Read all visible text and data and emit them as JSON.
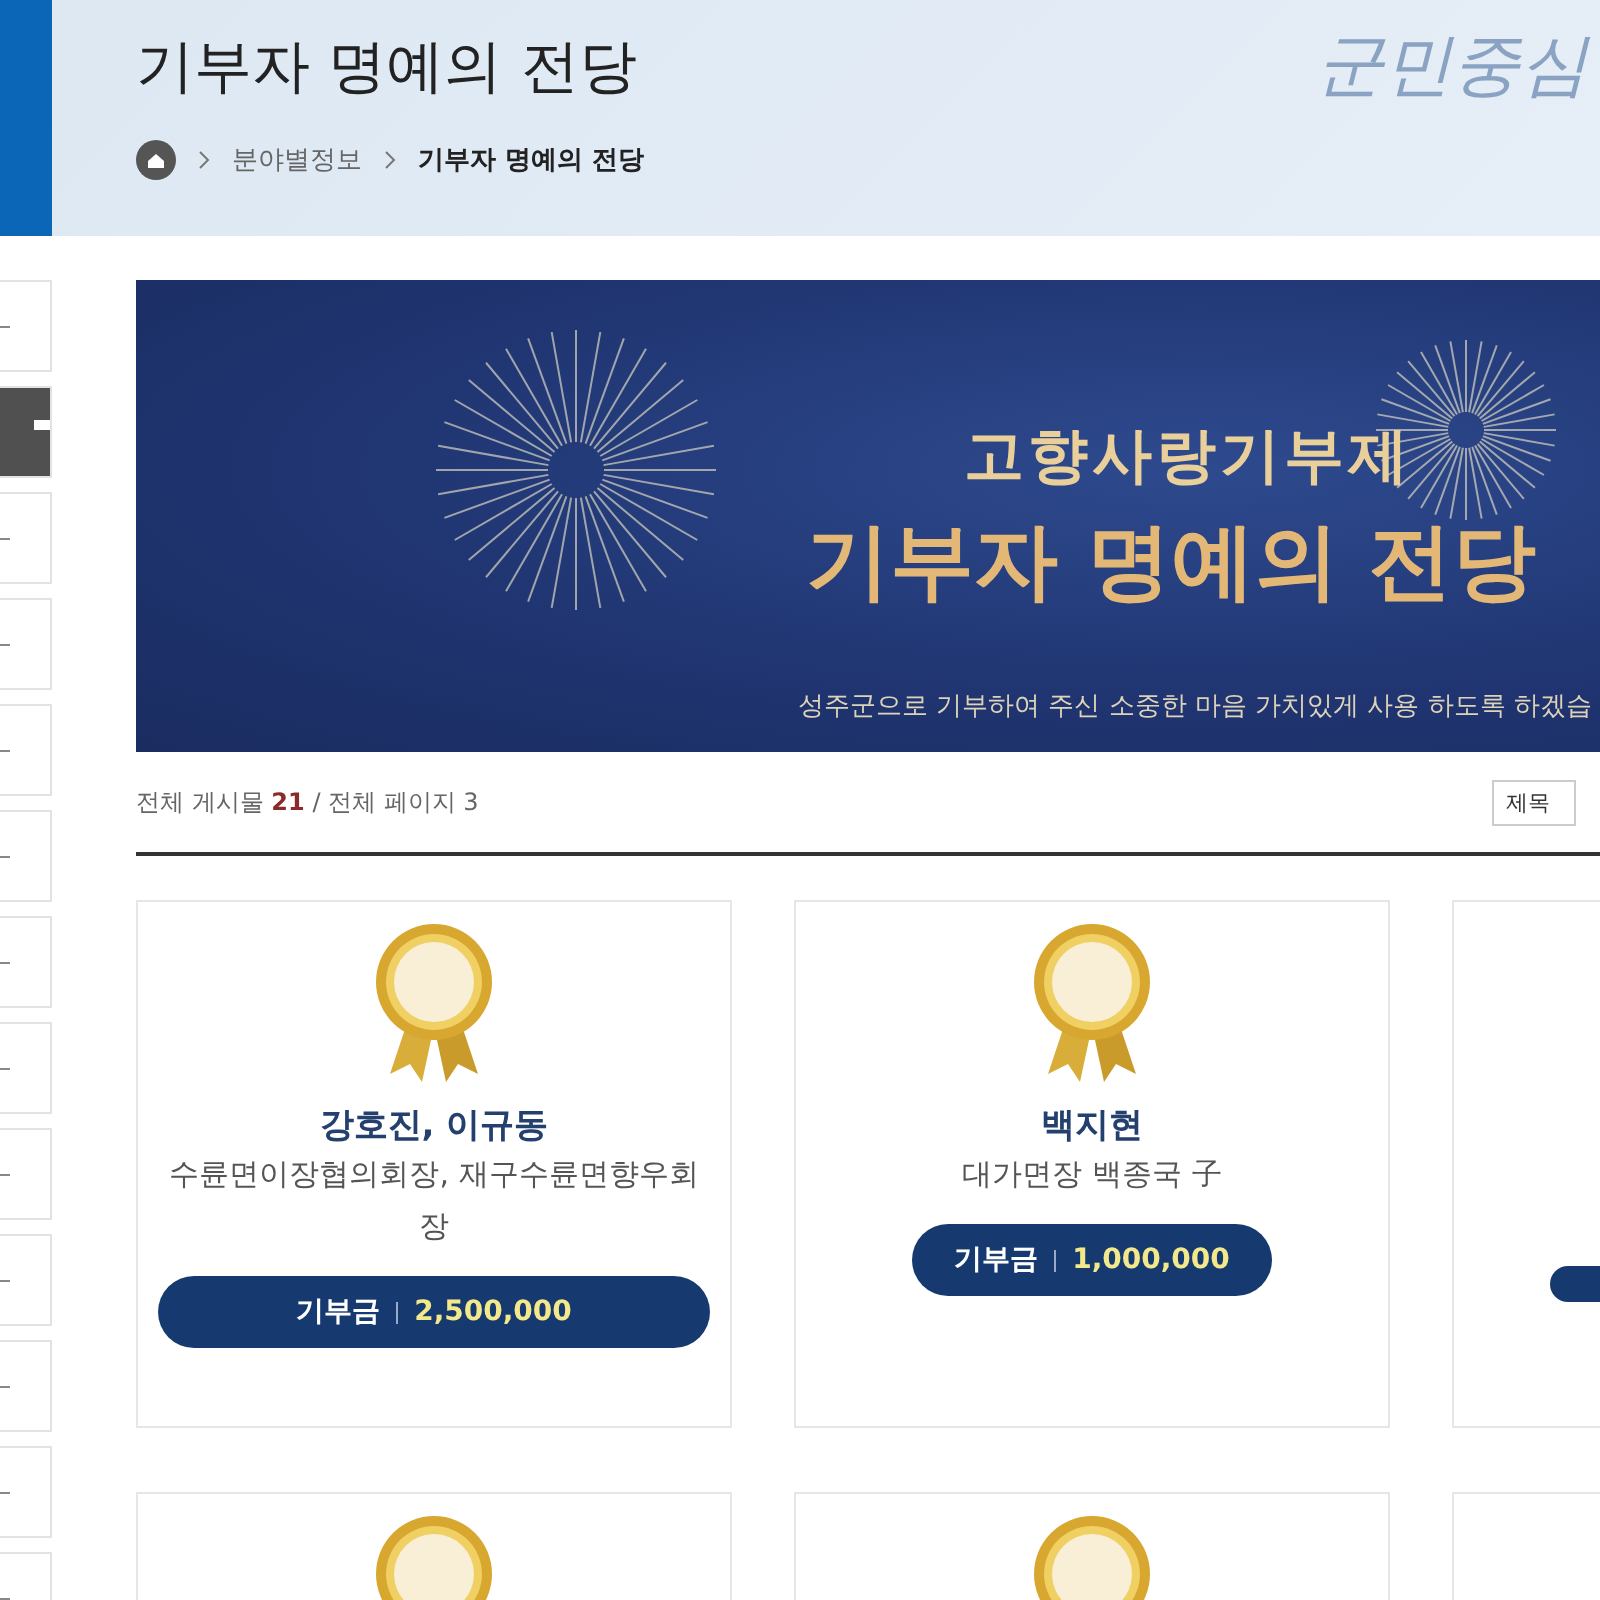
{
  "header": {
    "title": "기부자 명예의 전당",
    "motto": "군민중심",
    "breadcrumb": [
      {
        "label": "분야별정보",
        "current": false
      },
      {
        "label": "기부자 명예의 전당",
        "current": true
      }
    ]
  },
  "side_menu": [
    {
      "selected": false
    },
    {
      "selected": true
    },
    {
      "selected": false
    },
    {
      "selected": false
    },
    {
      "selected": false
    },
    {
      "selected": false
    },
    {
      "selected": false
    },
    {
      "selected": false
    },
    {
      "selected": false
    },
    {
      "selected": false
    },
    {
      "selected": false
    },
    {
      "selected": false
    },
    {
      "selected": false
    }
  ],
  "banner": {
    "subtitle": "고향사랑기부제",
    "title": "기부자 명예의 전당",
    "message": "성주군으로  기부하여 주신 소중한 마음 가치있게 사용 하도록 하겠습"
  },
  "summary": {
    "posts_label": "전체 게시물",
    "posts": "21",
    "pages_label": "/ 전체 페이지 3"
  },
  "search_select": {
    "value": "제목"
  },
  "cards": [
    {
      "kind": "donor",
      "name": "강호진, 이규동",
      "title": "수륜면이장협의회장, 재구수륜면향우회장",
      "label": "기부금",
      "amount": "2,500,000"
    },
    {
      "kind": "donor",
      "name": "백지현",
      "title": "대가면장 백종국 子",
      "label": "기부금",
      "amount": "1,000,000"
    },
    {
      "kind": "cut"
    },
    {
      "kind": "medal"
    },
    {
      "kind": "medal"
    },
    {
      "kind": "empty"
    }
  ]
}
